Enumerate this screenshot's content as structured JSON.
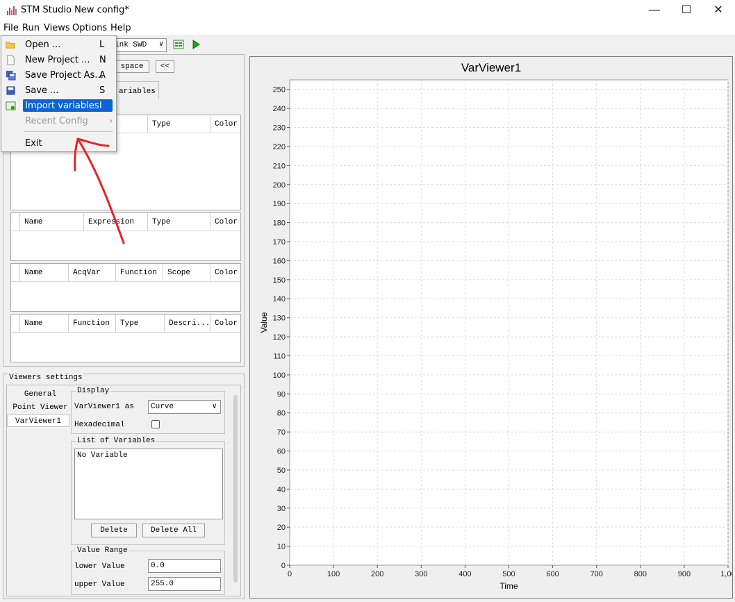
{
  "window": {
    "title": "STM Studio New config*",
    "minimize_glyph": "—",
    "maximize_glyph": "☐",
    "close_glyph": "✕"
  },
  "menubar": {
    "items": [
      "File",
      "Run",
      "Views",
      "Options",
      "Help"
    ]
  },
  "file_menu": {
    "items": [
      {
        "label": "Open ...",
        "shortcut": "L",
        "icon": "folder-open-icon"
      },
      {
        "label": "New Project ...",
        "shortcut": "N",
        "icon": "new-file-icon"
      },
      {
        "label": "Save Project As...",
        "shortcut": "A",
        "icon": "save-as-icon"
      },
      {
        "label": "Save ...",
        "shortcut": "S",
        "icon": "save-icon"
      },
      {
        "label": "Import variables",
        "shortcut": "I",
        "icon": "import-icon",
        "selected": true
      },
      {
        "label": "Recent Config",
        "shortcut": "›",
        "disabled": true
      },
      {
        "label": "Exit",
        "shortcut": ""
      }
    ]
  },
  "toolbar": {
    "probe_combo": "ink SWD",
    "combo_arrow": "∨"
  },
  "left_panel": {
    "workspace_button": "space",
    "collapse_button": "<<",
    "variables_tab": "ariables",
    "table1_headers": [
      "Type",
      "Color"
    ],
    "table2_headers": [
      "Name",
      "Expression",
      "Type",
      "Color"
    ],
    "table3_headers": [
      "Name",
      "AcqVar",
      "Function",
      "Scope",
      "Color"
    ],
    "table4_headers": [
      "Name",
      "Function",
      "Type",
      "Descri...",
      "Color"
    ]
  },
  "viewers_settings": {
    "title": "Viewers settings",
    "tabs": [
      "General",
      "Point Viewer",
      "VarViewer1"
    ],
    "display_group": "Display",
    "viewer_as_label": "VarViewer1 as",
    "viewer_as_value": "Curve",
    "hexadecimal_label": "Hexadecimal",
    "list_group": "List of Variables",
    "list_empty": "No Variable",
    "delete_button": "Delete",
    "delete_all_button": "Delete All",
    "range_group": "Value Range",
    "lower_label": "lower Value",
    "lower_value": "0.0",
    "upper_label": "upper Value",
    "upper_value": "255.0"
  },
  "chart_data": {
    "type": "line",
    "title": "VarViewer1",
    "xlabel": "Time",
    "ylabel": "Value",
    "xlim": [
      0,
      1000
    ],
    "ylim": [
      0,
      255
    ],
    "x_ticks": [
      "0",
      "100",
      "200",
      "300",
      "400",
      "500",
      "600",
      "700",
      "800",
      "900",
      "1,00"
    ],
    "y_ticks": [
      "0",
      "10",
      "20",
      "30",
      "40",
      "50",
      "60",
      "70",
      "80",
      "90",
      "100",
      "110",
      "120",
      "130",
      "140",
      "150",
      "160",
      "170",
      "180",
      "190",
      "200",
      "210",
      "220",
      "230",
      "240",
      "250"
    ],
    "grid": true,
    "series": []
  }
}
